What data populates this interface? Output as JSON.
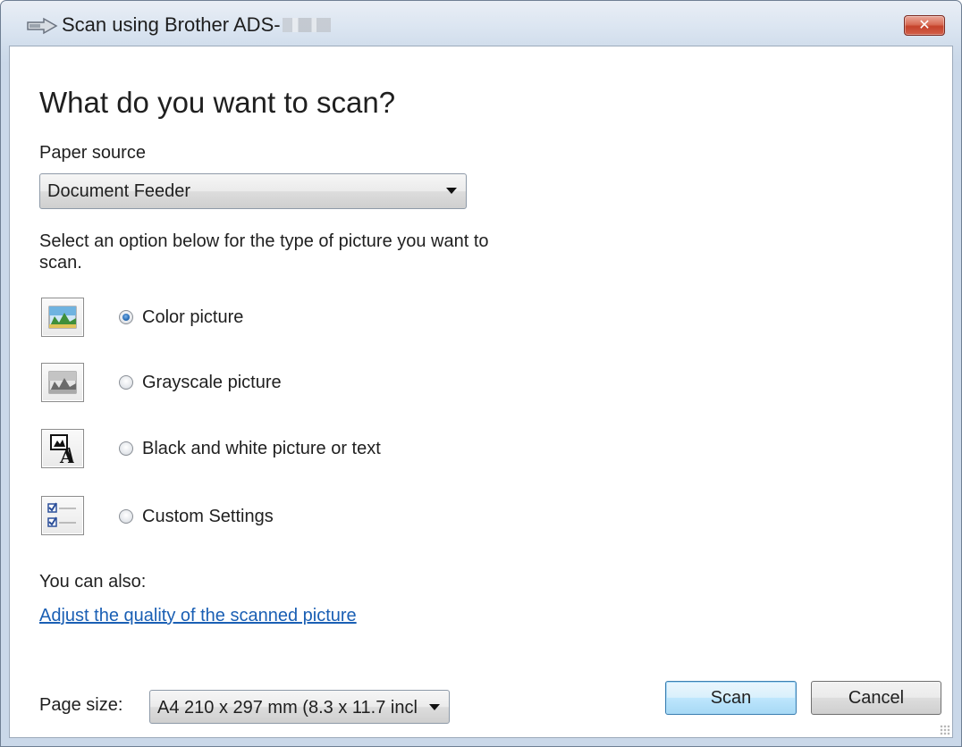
{
  "window": {
    "title": "Scan using Brother ADS-",
    "close_symbol": "✕"
  },
  "main": {
    "heading": "What do you want to scan?",
    "paper_source": {
      "label": "Paper source",
      "value": "Document Feeder"
    },
    "description": "Select an option below for the type of picture you want to scan.",
    "options": [
      {
        "label": "Color picture",
        "icon": "color-picture-icon",
        "selected": true
      },
      {
        "label": "Grayscale picture",
        "icon": "grayscale-picture-icon",
        "selected": false
      },
      {
        "label": "Black and white picture or text",
        "icon": "black-white-text-icon",
        "selected": false
      },
      {
        "label": "Custom Settings",
        "icon": "custom-settings-icon",
        "selected": false
      }
    ],
    "also_label": "You can also:",
    "adjust_link": "Adjust the quality of the scanned picture"
  },
  "footer": {
    "page_size_label": "Page size:",
    "page_size_value": "A4 210 x 297 mm (8.3 x 11.7 incl",
    "scan_button": "Scan",
    "cancel_button": "Cancel"
  }
}
